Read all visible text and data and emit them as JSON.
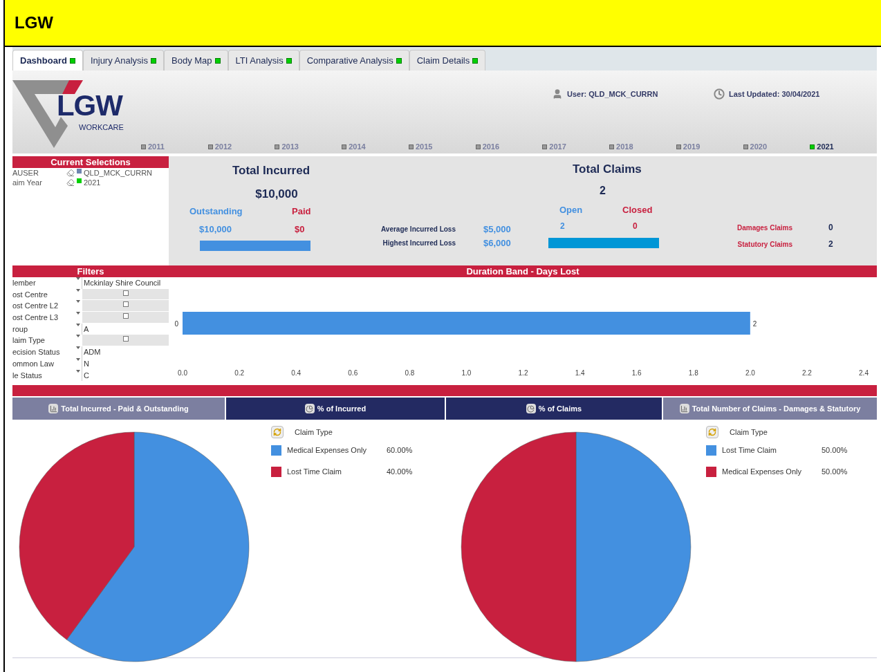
{
  "header": {
    "title": "LGW"
  },
  "tabs": [
    {
      "label": "Dashboard",
      "selected": true,
      "on": true
    },
    {
      "label": "Injury Analysis",
      "selected": false,
      "on": true
    },
    {
      "label": "Body Map",
      "selected": false,
      "on": true
    },
    {
      "label": "LTI Analysis",
      "selected": false,
      "on": true
    },
    {
      "label": "Comparative Analysis",
      "selected": false,
      "on": true
    },
    {
      "label": "Claim Details",
      "selected": false,
      "on": true
    }
  ],
  "logo": {
    "text": "LGW",
    "subtitle": "WORKCARE"
  },
  "user": "User: QLD_MCK_CURRN",
  "last_updated": "Last Updated: 30/04/2021",
  "years": [
    {
      "label": "2011",
      "selected": false
    },
    {
      "label": "2012",
      "selected": false
    },
    {
      "label": "2013",
      "selected": false
    },
    {
      "label": "2014",
      "selected": false
    },
    {
      "label": "2015",
      "selected": false
    },
    {
      "label": "2016",
      "selected": false
    },
    {
      "label": "2017",
      "selected": false
    },
    {
      "label": "2018",
      "selected": false
    },
    {
      "label": "2019",
      "selected": false
    },
    {
      "label": "2020",
      "selected": false
    },
    {
      "label": "2021",
      "selected": true
    }
  ],
  "current_selections": {
    "title": "Current Selections",
    "rows": [
      {
        "field": "AUSER",
        "value": "QLD_MCK_CURRN",
        "color": "#6f86b0"
      },
      {
        "field": "aim Year",
        "value": "2021",
        "color": "#00d000"
      }
    ]
  },
  "incurred": {
    "title": "Total Incurred",
    "value": "$10,000",
    "outstanding_label": "Outstanding",
    "paid_label": "Paid",
    "outstanding": "$10,000",
    "paid": "$0"
  },
  "losses": [
    {
      "label": "Average Incurred Loss",
      "value": "$5,000"
    },
    {
      "label": "Highest Incurred Loss",
      "value": "$6,000"
    }
  ],
  "claims": {
    "title": "Total Claims",
    "value": "2",
    "open_label": "Open",
    "closed_label": "Closed",
    "open": "2",
    "closed": "0"
  },
  "claim_types": [
    {
      "label": "Damages Claims",
      "value": "0"
    },
    {
      "label": "Statutory Claims",
      "value": "2"
    }
  ],
  "filters": {
    "title": "Filters",
    "rows": [
      {
        "field": "lember",
        "value": "Mckinlay Shire Council"
      },
      {
        "field": "ost Centre",
        "checked": false
      },
      {
        "field": "ost Centre L2",
        "checked": false
      },
      {
        "field": "ost Centre L3",
        "checked": false
      },
      {
        "field": "roup",
        "value": "A"
      },
      {
        "field": "laim Type",
        "checked": false
      },
      {
        "field": "ecision Status",
        "value": "ADM"
      },
      {
        "field": "ommon Law",
        "value": "N"
      },
      {
        "field": "le Status",
        "value": "C"
      }
    ]
  },
  "duration": {
    "title": "Duration Band - Days Lost",
    "chart_data": {
      "type": "bar",
      "orientation": "horizontal",
      "categories": [
        "0"
      ],
      "values": [
        2
      ],
      "xlim": [
        0,
        2.4
      ],
      "data_labels": true,
      "xticks": [
        {
          "value": 0,
          "label": "0.0"
        },
        {
          "value": 0.2,
          "label": "0.2"
        },
        {
          "value": 0.4,
          "label": "0.4"
        },
        {
          "value": 0.6,
          "label": "0.6"
        },
        {
          "value": 0.8,
          "label": "0.8"
        },
        {
          "value": 1,
          "label": "1.0"
        },
        {
          "value": 1.2,
          "label": "1.2"
        },
        {
          "value": 1.4,
          "label": "1.4"
        },
        {
          "value": 1.6,
          "label": "1.6"
        },
        {
          "value": 1.8,
          "label": "1.8"
        },
        {
          "value": 2,
          "label": "2.0"
        },
        {
          "value": 2.2,
          "label": "2.2"
        },
        {
          "value": 2.4,
          "label": "2.4"
        }
      ]
    }
  },
  "chart_tabs": [
    {
      "label": "Total Incurred - Paid & Outstanding",
      "kind": "bar",
      "selected": false
    },
    {
      "label": "% of Incurred",
      "kind": "pie",
      "selected": true
    },
    {
      "label": "% of Claims",
      "kind": "pie",
      "selected": true
    },
    {
      "label": "Total Number of Claims - Damages & Statutory",
      "kind": "bar",
      "selected": false
    }
  ],
  "pies": [
    {
      "chart_data": {
        "type": "pie",
        "title": "Claim Type",
        "categories": [
          "Medical Expenses Only",
          "Lost Time Claim"
        ],
        "values": [
          60,
          40
        ],
        "value_labels": [
          "60.00%",
          "40.00%"
        ],
        "colors": [
          "#4390e0",
          "#c8203f"
        ]
      }
    },
    {
      "chart_data": {
        "type": "pie",
        "title": "Claim Type",
        "categories": [
          "Lost Time Claim",
          "Medical Expenses Only"
        ],
        "values": [
          50,
          50
        ],
        "value_labels": [
          "50.00%",
          "50.00%"
        ],
        "colors": [
          "#4390e0",
          "#c8203f"
        ]
      }
    }
  ]
}
